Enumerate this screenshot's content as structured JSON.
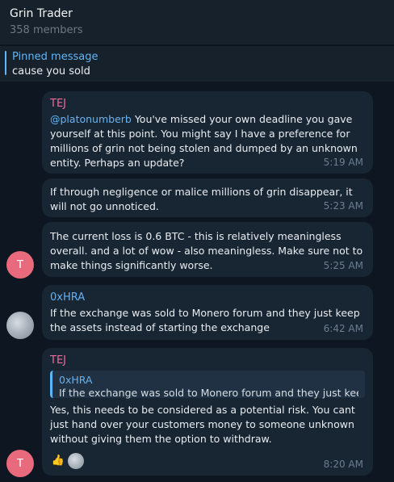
{
  "header": {
    "title": "Grin Trader",
    "members": "358 members"
  },
  "pinned": {
    "label": "Pinned message",
    "text": "cause you sold"
  },
  "messages": [
    {
      "sender": "TEJ",
      "mention": "@platonumberb",
      "text": " You've missed your own deadline you gave yourself at this point. You might say I have a preference for millions of grin not being stolen and dumped by an unknown entity. Perhaps an update?",
      "time": "5:19 AM"
    },
    {
      "text": "If through negligence or malice millions of grin disappear, it will not go unnoticed.",
      "time": "5:23 AM"
    },
    {
      "text": "The current loss is 0.6 BTC - this is relatively meaningless overall. and a lot of wow - also meaningless. Make sure not to make things significantly worse.",
      "time": "5:25 AM",
      "avatar": "T"
    },
    {
      "sender": "0xHRA",
      "text": "If the exchange was sold to Monero forum and they just keep the assets instead of starting the exchange",
      "time": "6:42 AM"
    },
    {
      "sender": "TEJ",
      "reply_name": "0xHRA",
      "reply_text": "If the exchange was sold to Monero forum and they just kee...",
      "text": "Yes, this needs to be considered as a potential risk. You cant just hand over your customers money to someone unknown without giving them the option to withdraw.",
      "reaction": "👍",
      "time": "8:20 AM",
      "avatar": "T"
    }
  ],
  "colors": {
    "background": "#0e1621",
    "bubble": "#182533",
    "accent": "#5eb5f7",
    "tej_name": "#f06b9a"
  }
}
